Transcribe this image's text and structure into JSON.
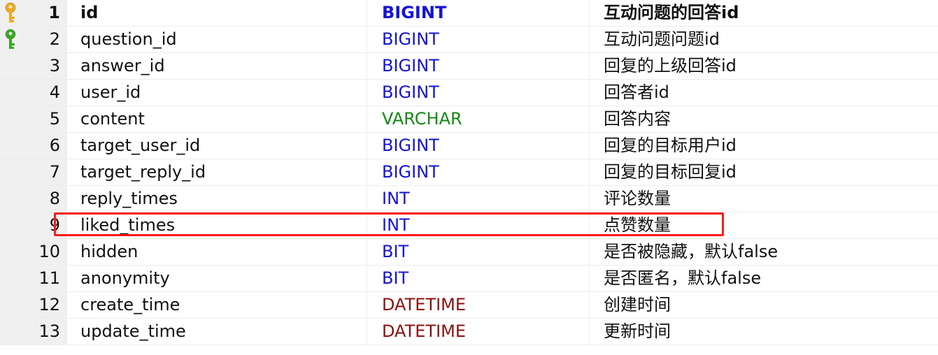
{
  "columns": [
    {
      "num": "1",
      "name": "id",
      "type": "BIGINT",
      "type_color": "#1414d6",
      "comment": "互动问题的回答id",
      "key": "primary",
      "bold": true
    },
    {
      "num": "2",
      "name": "question_id",
      "type": "BIGINT",
      "type_color": "#1414d6",
      "comment": "互动问题问题id",
      "key": "foreign",
      "bold": false
    },
    {
      "num": "3",
      "name": "answer_id",
      "type": "BIGINT",
      "type_color": "#1414d6",
      "comment": "回复的上级回答id",
      "key": "",
      "bold": false
    },
    {
      "num": "4",
      "name": "user_id",
      "type": "BIGINT",
      "type_color": "#1414d6",
      "comment": "回答者id",
      "key": "",
      "bold": false
    },
    {
      "num": "5",
      "name": "content",
      "type": "VARCHAR",
      "type_color": "#138a13",
      "comment": "回答内容",
      "key": "",
      "bold": false
    },
    {
      "num": "6",
      "name": "target_user_id",
      "type": "BIGINT",
      "type_color": "#1414d6",
      "comment": "回复的目标用户id",
      "key": "",
      "bold": false
    },
    {
      "num": "7",
      "name": "target_reply_id",
      "type": "BIGINT",
      "type_color": "#1414d6",
      "comment": "回复的目标回复id",
      "key": "",
      "bold": false
    },
    {
      "num": "8",
      "name": "reply_times",
      "type": "INT",
      "type_color": "#1414d6",
      "comment": "评论数量",
      "key": "",
      "bold": false
    },
    {
      "num": "9",
      "name": "liked_times",
      "type": "INT",
      "type_color": "#1414d6",
      "comment": "点赞数量",
      "key": "",
      "bold": false
    },
    {
      "num": "10",
      "name": "hidden",
      "type": "BIT",
      "type_color": "#1414d6",
      "comment": "是否被隐藏，默认false",
      "key": "",
      "bold": false
    },
    {
      "num": "11",
      "name": "anonymity",
      "type": "BIT",
      "type_color": "#1414d6",
      "comment": "是否匿名，默认false",
      "key": "",
      "bold": false
    },
    {
      "num": "12",
      "name": "create_time",
      "type": "DATETIME",
      "type_color": "#8b1010",
      "comment": "创建时间",
      "key": "",
      "bold": false
    },
    {
      "num": "13",
      "name": "update_time",
      "type": "DATETIME",
      "type_color": "#8b1010",
      "comment": "更新时间",
      "key": "",
      "bold": false
    }
  ],
  "icons": {
    "primary_key": "primary-key-icon",
    "foreign_key": "foreign-key-icon",
    "primary_key_color": "#f2a818",
    "foreign_key_color": "#3aa829"
  },
  "highlight": {
    "row_num": "9",
    "color": "#ff1a1a"
  }
}
